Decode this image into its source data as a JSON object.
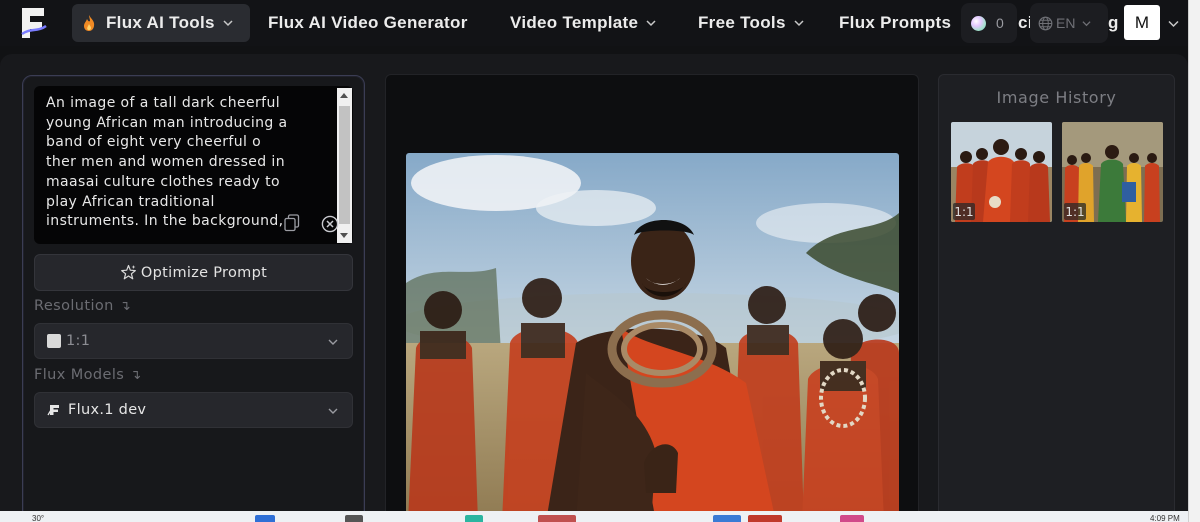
{
  "nav": {
    "logo": "F",
    "items": [
      {
        "label": "Flux AI Tools",
        "active": true
      },
      {
        "label": "Flux AI Video Generator"
      },
      {
        "label": "Video Template"
      },
      {
        "label": "Free Tools"
      },
      {
        "label": "Flux Prompts"
      }
    ],
    "overlap_text_1": "ci",
    "overlap_text_2": "g",
    "credits": "0",
    "language": "EN",
    "avatar_initial": "M"
  },
  "prompt": {
    "lines": [
      "An image of a tall dark cheerful",
      "young African man introducing a",
      "band of eight very cheerful o",
      "ther men and women dressed in",
      "maasai culture clothes ready to",
      "play African traditional",
      "instruments. In the background,"
    ]
  },
  "optimize_label": "Optimize Prompt",
  "resolution": {
    "label": "Resolution",
    "hook": "↴",
    "value": "1:1"
  },
  "models": {
    "label": "Flux Models",
    "hook": "↴",
    "value": "Flux.1 dev"
  },
  "history": {
    "title": "Image History",
    "items": [
      {
        "ratio": "1:1"
      },
      {
        "ratio": "1:1"
      }
    ]
  },
  "taskbar": {
    "temperature": "30°",
    "clock": "4:09 PM"
  },
  "colors": {
    "accent_border": "#3b3d54",
    "background": "#111214",
    "robe": "#c8401f",
    "flame": "#f08a24"
  }
}
